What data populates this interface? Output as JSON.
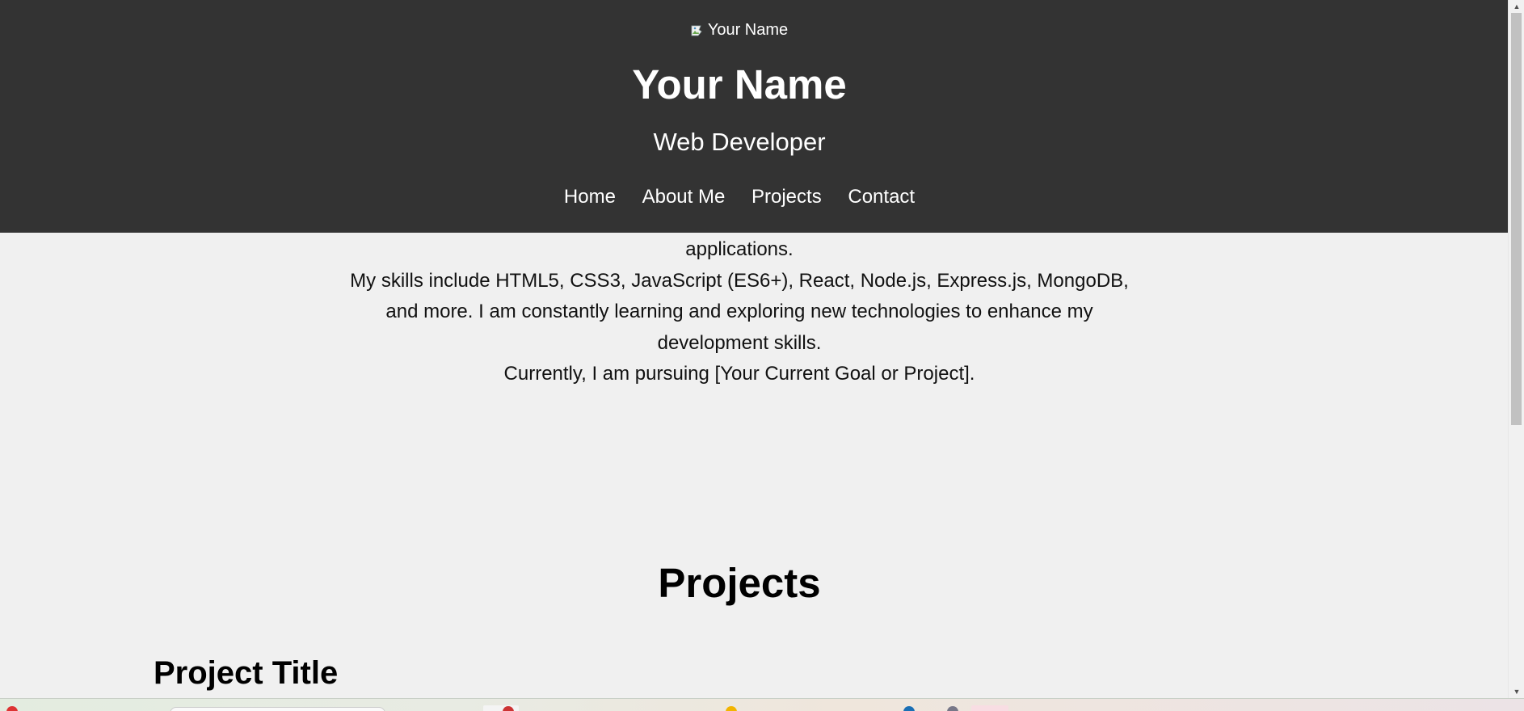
{
  "header": {
    "image_alt": "Your Name",
    "title": "Your Name",
    "subtitle": "Web Developer",
    "nav": [
      {
        "label": "Home"
      },
      {
        "label": "About Me"
      },
      {
        "label": "Projects"
      },
      {
        "label": "Contact"
      }
    ]
  },
  "about": {
    "lines": [
      "applications.",
      "My skills include HTML5, CSS3, JavaScript (ES6+), React, Node.js, Express.js, MongoDB,",
      "and more. I am constantly learning and exploring new technologies to enhance my",
      "development skills.",
      "Currently, I am pursuing [Your Current Goal or Project]."
    ]
  },
  "projects": {
    "heading": "Projects",
    "first_title": "Project Title"
  },
  "colors": {
    "header_bg": "#333333",
    "page_bg": "#f0f0f0",
    "text": "#111111"
  }
}
